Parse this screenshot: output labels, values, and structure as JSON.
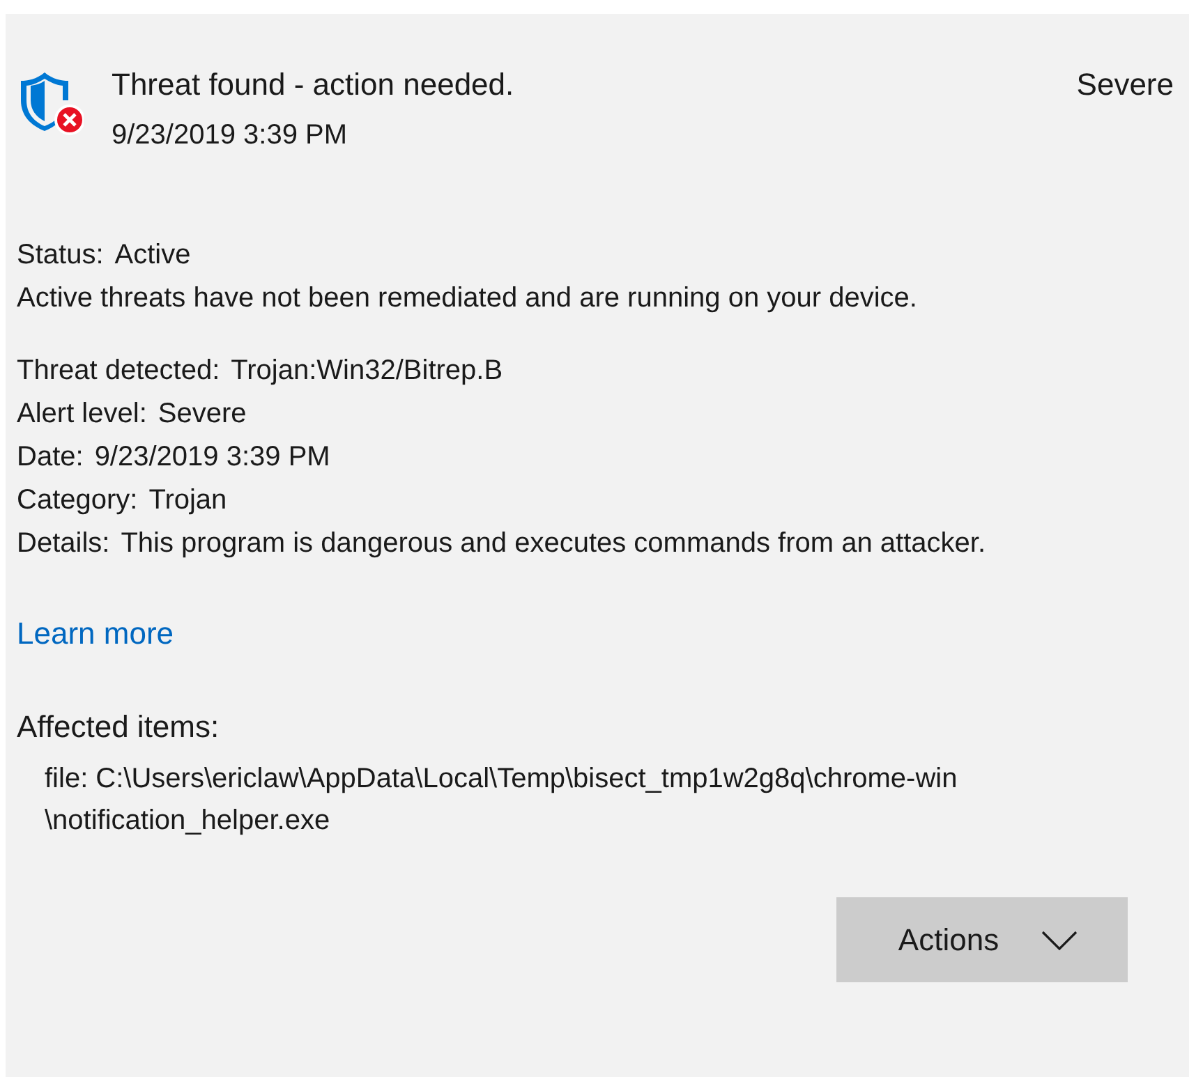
{
  "header": {
    "title": "Threat found - action needed.",
    "date": "9/23/2019 3:39 PM",
    "severity": "Severe"
  },
  "status": {
    "label": "Status:",
    "value": "Active"
  },
  "status_description": "Active threats have not been remediated and are running on your device.",
  "details": [
    {
      "label": "Threat detected:",
      "value": "Trojan:Win32/Bitrep.B"
    },
    {
      "label": "Alert level:",
      "value": "Severe"
    },
    {
      "label": "Date:",
      "value": "9/23/2019 3:39 PM"
    },
    {
      "label": "Category:",
      "value": "Trojan"
    },
    {
      "label": "Details:",
      "value": "This program is dangerous and executes commands from an attacker."
    }
  ],
  "learn_more": "Learn more",
  "affected_items": {
    "title": "Affected items:",
    "lines": [
      "file: C:\\Users\\ericlaw\\AppData\\Local\\Temp\\bisect_tmp1w2g8q\\chrome-win",
      "\\notification_helper.exe"
    ]
  },
  "actions_button": "Actions"
}
